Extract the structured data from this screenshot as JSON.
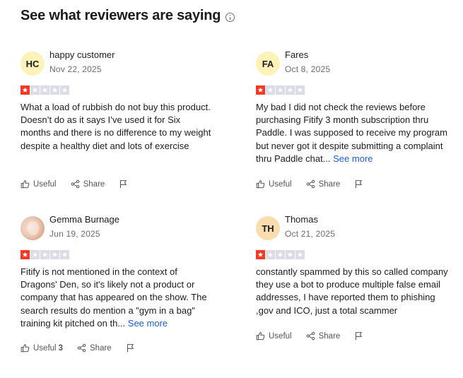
{
  "section": {
    "title": "See what reviewers are saying"
  },
  "colors": {
    "star_on": "#ff3722",
    "star_off": "#dcdce6",
    "link": "#1c5fcf"
  },
  "actions": {
    "useful": "Useful",
    "share": "Share"
  },
  "reviews": [
    {
      "initials": "HC",
      "name": "happy customer",
      "date": "Nov 22, 2025",
      "rating": 1,
      "text": "What a load of rubbish do not buy this product. Doesn’t do as it says I’ve used it for Six months and there is no difference to my weight despite a healthy diet and lots of exercise",
      "see_more": ""
    },
    {
      "initials": "FA",
      "name": "Fares",
      "date": "Oct 8, 2025",
      "rating": 1,
      "text": "My bad I did not check the reviews before purchasing Fitify 3 month subscription thru Paddle. I was supposed to receive my program but never got it despite submitting a complaint thru Paddle chat...",
      "see_more": "See more"
    },
    {
      "initials": "",
      "name": "Gemma Burnage",
      "date": "Jun 19, 2025",
      "rating": 1,
      "text": "Fitify is not mentioned in the context of Dragons' Den, so it's likely not a product or company that has appeared on the show. The search results do mention a \"gym in a bag\" training kit pitched on th...",
      "see_more": "See more",
      "useful_count": "3"
    },
    {
      "initials": "TH",
      "name": "Thomas",
      "date": "Oct 21, 2025",
      "rating": 1,
      "text": "constantly spammed by this so called company they use a bot to produce multiple false email addresses, I have reported them to phishing ,gov and ICO, just a total scammer",
      "see_more": ""
    }
  ]
}
